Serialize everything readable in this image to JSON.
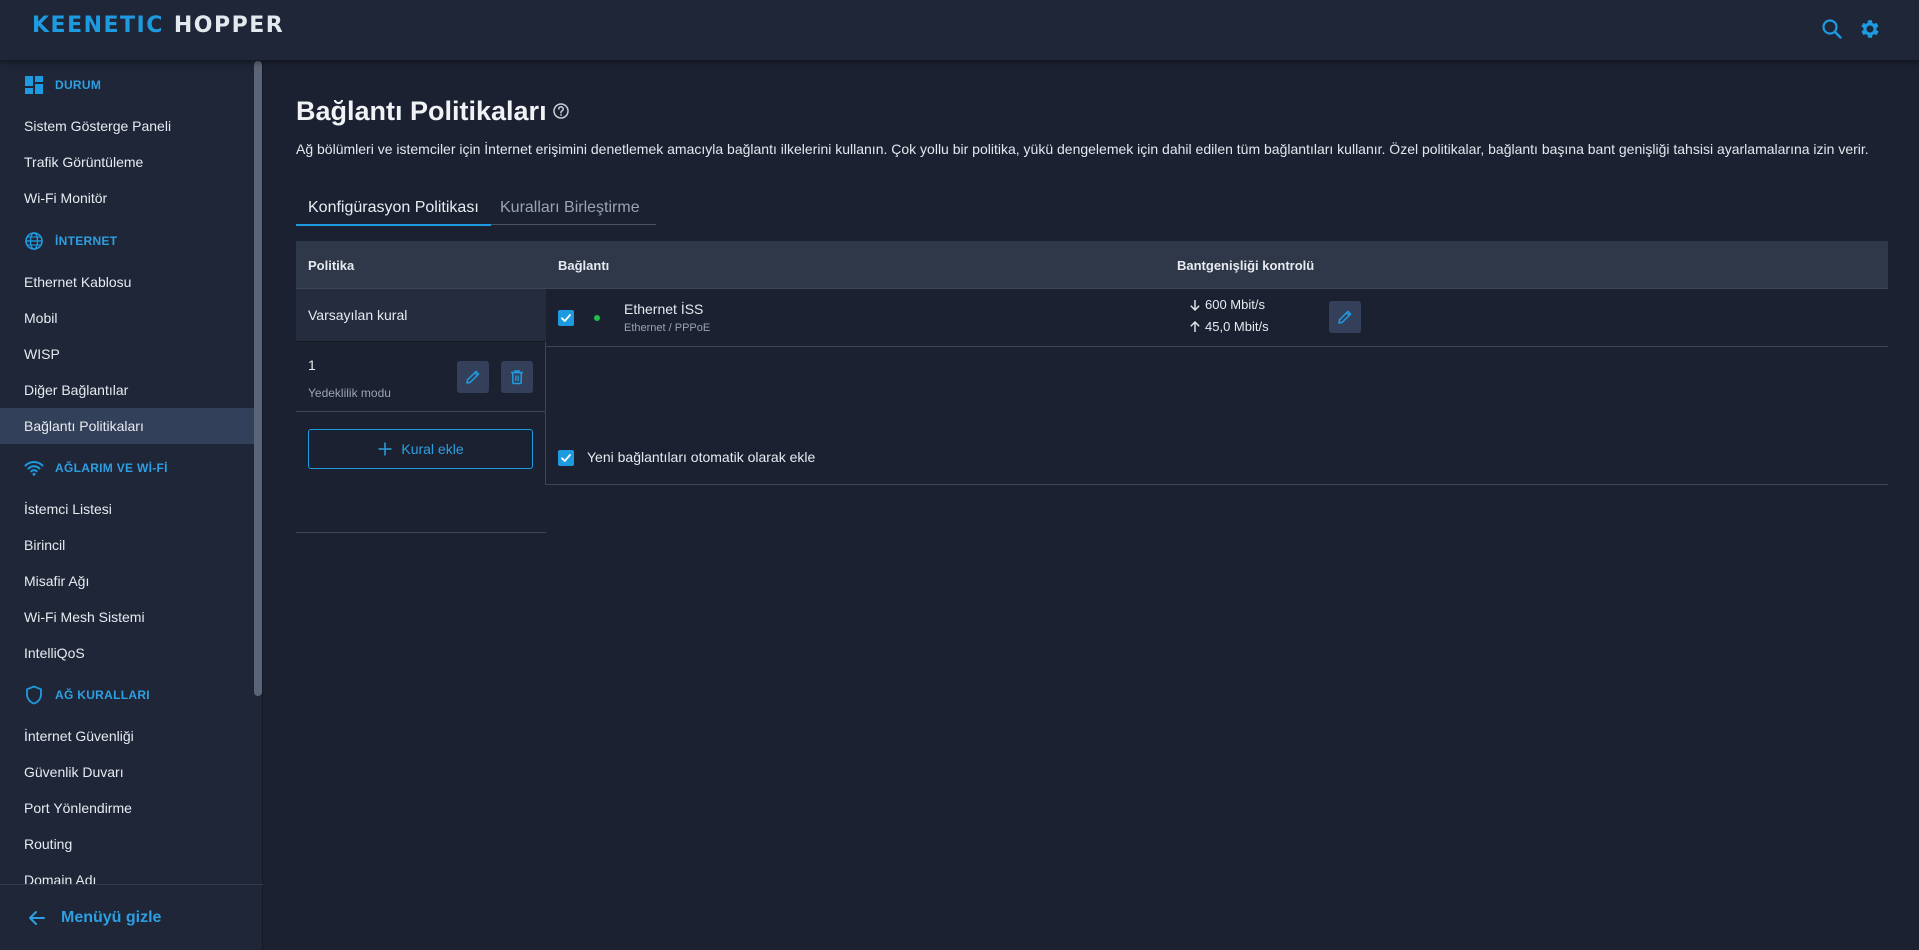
{
  "brand": {
    "part1": "KEENETIC",
    "part2": "HOPPER",
    "accent": "#1e9be0"
  },
  "topbar": {
    "search_icon": "search-icon",
    "settings_icon": "gear-icon"
  },
  "sidebar": {
    "sections": [
      {
        "label": "DURUM",
        "icon": "dashboard-icon",
        "items": [
          "Sistem Gösterge Paneli",
          "Trafik Görüntüleme",
          "Wi-Fi Monitör"
        ]
      },
      {
        "label": "İNTERNET",
        "icon": "globe-icon",
        "items": [
          "Ethernet Kablosu",
          "Mobil",
          "WISP",
          "Diğer Bağlantılar",
          "Bağlantı Politikaları"
        ]
      },
      {
        "label": "AĞLARIM VE Wİ-Fİ",
        "icon": "wifi-icon",
        "items": [
          "İstemci Listesi",
          "Birincil",
          "Misafir Ağı",
          "Wi-Fi Mesh Sistemi",
          "IntelliQoS"
        ]
      },
      {
        "label": "AĞ KURALLARI",
        "icon": "shield-icon",
        "items": [
          "İnternet Güvenliği",
          "Güvenlik Duvarı",
          "Port Yönlendirme",
          "Routing",
          "Domain Adı"
        ]
      }
    ],
    "active_item": "Bağlantı Politikaları",
    "hide_menu": "Menüyü gizle"
  },
  "page": {
    "title": "Bağlantı Politikaları",
    "description": "Ağ bölümleri ve istemciler için İnternet erişimini denetlemek amacıyla bağlantı ilkelerini kullanın. Çok yollu bir politika, yükü dengelemek için dahil edilen tüm bağlantıları kullanır. Özel politikalar, bağlantı başına bant genişliği tahsisi ayarlamalarına izin verir.",
    "tabs": [
      {
        "label": "Konfigürasyon Politikası",
        "active": true
      },
      {
        "label": "Kuralları Birleştirme",
        "active": false
      }
    ]
  },
  "table": {
    "headers": {
      "policy": "Politika",
      "connection": "Bağlantı",
      "bandwidth": "Bantgenişliği kontrolü"
    },
    "policies": [
      {
        "name": "Varsayılan kural"
      },
      {
        "name": "1",
        "subtitle": "Yedeklilik modu"
      }
    ],
    "add_rule": "Kural ekle",
    "connection": {
      "checked": true,
      "status_color": "#1fbf4c",
      "name": "Ethernet İSS",
      "type": "Ethernet / PPPoE",
      "download": "600 Mbit/s",
      "upload": "45,0 Mbit/s"
    },
    "auto_add": {
      "checked": true,
      "label": "Yeni bağlantıları otomatik olarak ekle"
    }
  }
}
